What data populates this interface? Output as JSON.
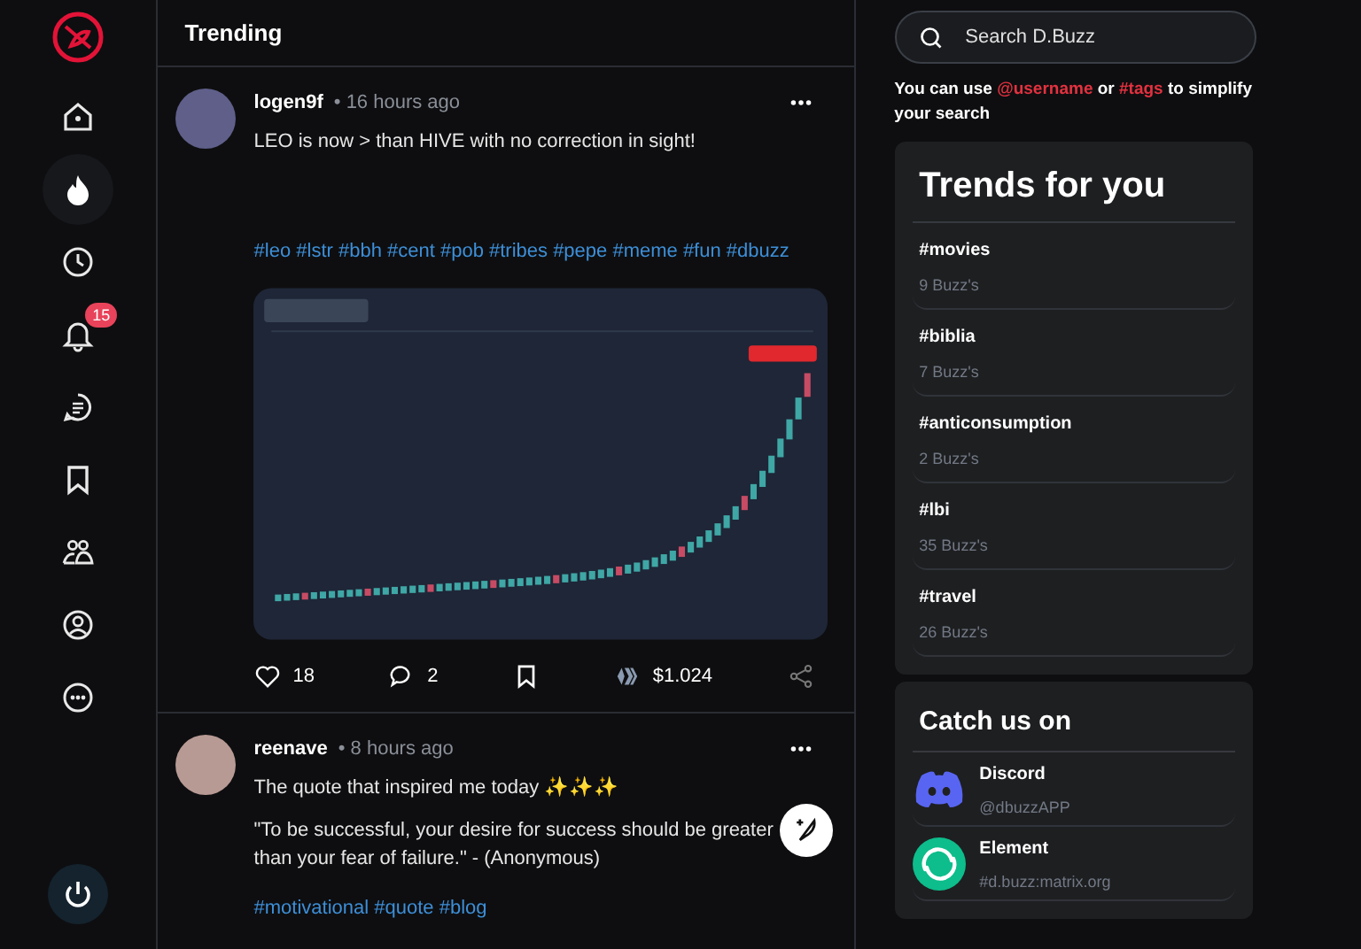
{
  "nav": {
    "items": [
      {
        "selected": false
      },
      {
        "selected": true
      },
      {
        "selected": false
      },
      {
        "selected": false,
        "badge": "15"
      },
      {
        "selected": false
      },
      {
        "selected": false
      },
      {
        "selected": false
      },
      {
        "selected": false
      },
      {
        "selected": false
      }
    ]
  },
  "feed": {
    "title": "Trending",
    "posts": [
      {
        "author": "logen9f",
        "time": "• 16 hours ago",
        "lines": [
          "LEO is now > than HIVE with no correction in sight!"
        ],
        "tags": "#leo #lstr #bbh #cent #pob #tribes #pepe #meme #fun #dbuzz",
        "likes": "18",
        "comments": "2",
        "payout": "$1.024"
      },
      {
        "author": "reenave",
        "time": "• 8 hours ago",
        "lines": [
          "The quote that inspired me today ✨✨✨",
          "\"To be successful, your desire for success should be greater than your fear of failure.\" - (Anonymous)"
        ],
        "tags": "#motivational #quote #blog"
      }
    ]
  },
  "search": {
    "placeholder": "Search D.Buzz",
    "hint": [
      {
        "text": "You can use ",
        "highlight": false
      },
      {
        "text": "@username",
        "highlight": true
      },
      {
        "text": " or ",
        "highlight": false
      },
      {
        "text": "#tags",
        "highlight": true
      },
      {
        "text": " to simplify your search",
        "highlight": false
      }
    ]
  },
  "trends": {
    "title": "Trends for you",
    "items": [
      {
        "tag": "#movies",
        "count": "9 Buzz's"
      },
      {
        "tag": "#biblia",
        "count": "7 Buzz's"
      },
      {
        "tag": "#anticonsumption",
        "count": "2 Buzz's"
      },
      {
        "tag": "#lbi",
        "count": "35 Buzz's"
      },
      {
        "tag": "#travel",
        "count": "26 Buzz's"
      }
    ]
  },
  "catch": {
    "title": "Catch us on",
    "items": [
      {
        "kind": "discord",
        "name": "Discord",
        "handle": "@dbuzzAPP"
      },
      {
        "kind": "element",
        "name": "Element",
        "handle": "#d.buzz:matrix.org"
      }
    ]
  }
}
